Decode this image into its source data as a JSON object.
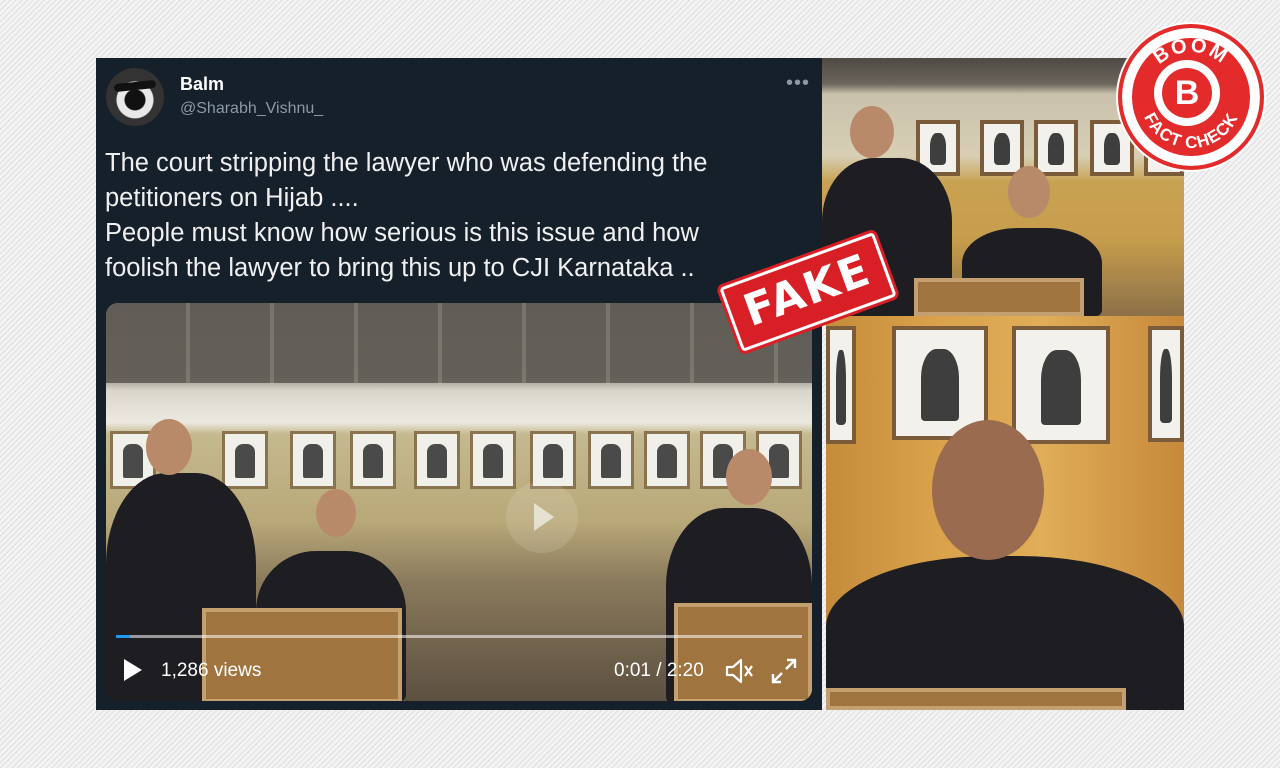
{
  "tweet": {
    "display_name": "Balm",
    "handle": "@Sharabh_Vishnu_",
    "more_icon": "•••",
    "text_lines": [
      "The court stripping the lawyer who was defending the",
      "petitioners on Hijab ....",
      "People must know how serious is this issue and how",
      "foolish the lawyer to bring this up to CJI Karnataka .."
    ]
  },
  "video": {
    "views": "1,286 views",
    "time": "0:01 / 2:20",
    "progress": 0.007
  },
  "stamps": {
    "fake_label": "FAKE",
    "boom_top": "BOOM",
    "boom_letter": "B",
    "boom_bottom": "FACT CHECK"
  },
  "colors": {
    "tweet_bg": "#15202b",
    "fake_red": "#d81f26",
    "boom_red": "#e32b2b",
    "progress_blue": "#1d9bf0"
  }
}
